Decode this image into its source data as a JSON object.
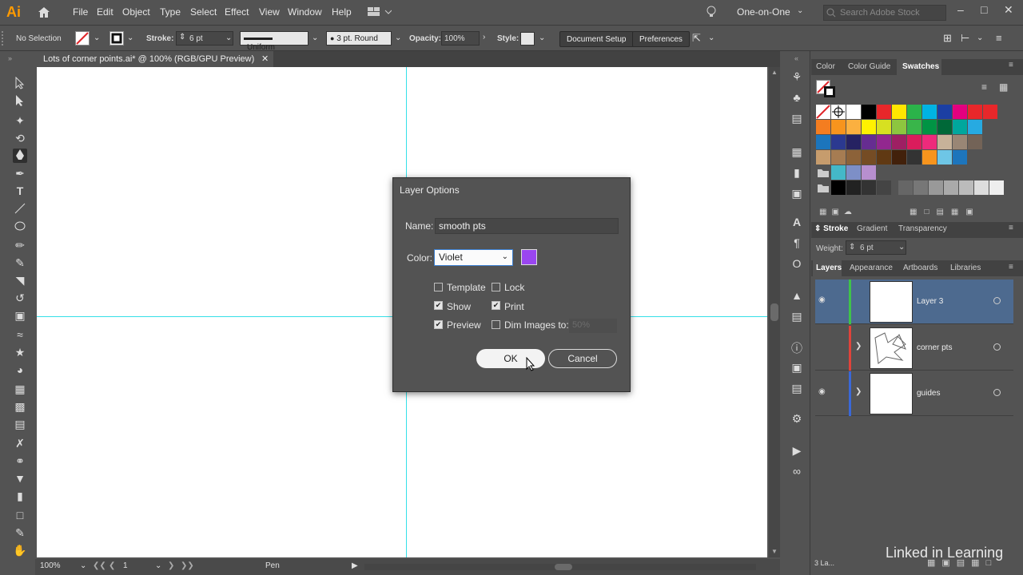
{
  "app": {
    "logo": "Ai"
  },
  "menu": [
    "File",
    "Edit",
    "Object",
    "Type",
    "Select",
    "Effect",
    "View",
    "Window",
    "Help"
  ],
  "workspace": "One-on-One",
  "search_placeholder": "Search Adobe Stock",
  "control_bar": {
    "selection": "No Selection",
    "stroke_label": "Stroke:",
    "stroke_value": "6 pt",
    "profile": "Uniform",
    "brush": "3 pt. Round",
    "opacity_label": "Opacity:",
    "opacity_value": "100%",
    "style_label": "Style:",
    "document_setup": "Document Setup",
    "preferences": "Preferences"
  },
  "document_tab": "Lots of corner points.ai* @ 100% (RGB/GPU Preview)",
  "status": {
    "zoom": "100%",
    "artboard": "1",
    "tool": "Pen"
  },
  "dialog": {
    "title": "Layer Options",
    "name_label": "Name:",
    "name_value": "smooth pts",
    "color_label": "Color:",
    "color_value": "Violet",
    "swatch_color": "#9a46f0",
    "template": "Template",
    "lock": "Lock",
    "show": "Show",
    "print": "Print",
    "preview": "Preview",
    "dim_images": "Dim Images to:",
    "dim_value": "50%",
    "checked": {
      "template": false,
      "lock": false,
      "show": true,
      "print": true,
      "preview": true,
      "dim": false
    },
    "ok": "OK",
    "cancel": "Cancel"
  },
  "color_panel_tabs": [
    "Color",
    "Color Guide",
    "Swatches"
  ],
  "stroke_panel": {
    "tabs": [
      "Stroke",
      "Gradient",
      "Transparency"
    ],
    "weight_label": "Weight:",
    "weight_value": "6 pt"
  },
  "layers_panel": {
    "tabs": [
      "Layers",
      "Appearance",
      "Artboards",
      "Libraries"
    ],
    "layers": [
      {
        "name": "Layer 3",
        "color": "#3fc24a",
        "selected": true
      },
      {
        "name": "corner pts",
        "color": "#e0433b",
        "selected": false
      },
      {
        "name": "guides",
        "color": "#3a68d8",
        "selected": false
      }
    ],
    "count": "3 La..."
  },
  "watermark": "Linked in Learning"
}
